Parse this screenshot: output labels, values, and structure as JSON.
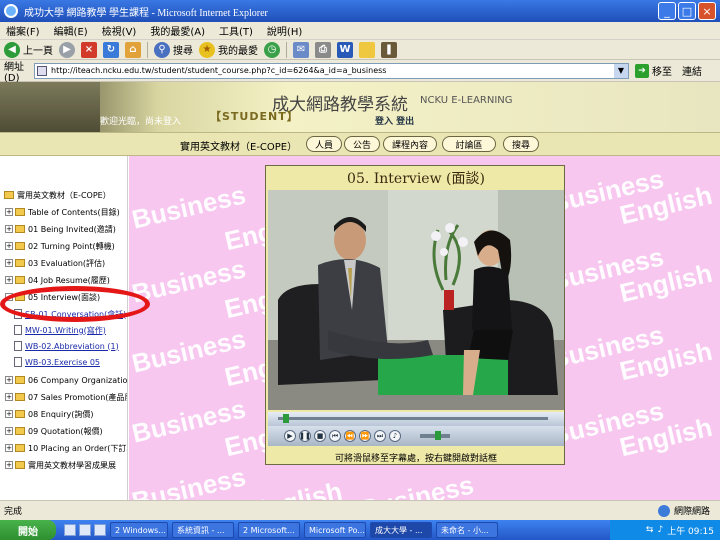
{
  "window": {
    "title": "成功大學 網路教學 學生課程 - Microsoft Internet Explorer",
    "controls": [
      "_",
      "□",
      "×"
    ]
  },
  "menu": [
    "檔案(F)",
    "編輯(E)",
    "檢視(V)",
    "我的最愛(A)",
    "工具(T)",
    "說明(H)"
  ],
  "toolbar": {
    "back": "上一頁",
    "search": "搜尋",
    "favorites": "我的最愛"
  },
  "address": {
    "label": "網址(D)",
    "url": "http://iteach.ncku.edu.tw/student/student_course.php?c_id=6264&a_id=a_business",
    "go": "移至",
    "links": "連結"
  },
  "banner": {
    "student_tag": "【STUDENT】",
    "system_name": "成大網路教學系統",
    "system_en": "NCKU E-LEARNING",
    "welcome": "歡迎光臨，尚未登入",
    "logout": "登入 登出"
  },
  "nav": {
    "course": "實用英文教材（E-COPE）",
    "buttons": [
      "人員",
      "公告",
      "課程內容",
      "討論區",
      "搜尋"
    ]
  },
  "tree": {
    "root": "實用英文教材（E-COPE）",
    "items": [
      "Table of Contents(目錄)",
      "01 Being Invited(邀請)",
      "02 Turning Point(轉機)",
      "03 Evaluation(評估)",
      "04 Job Resume(履歷)",
      "05 Interview(面談)"
    ],
    "sub_items": [
      "SB-01.Conversation(會話)",
      "MW-01.Writing(寫作)",
      "WB-02.Abbreviation (1)",
      "WB-03.Exercise 05"
    ],
    "more_items": [
      "06 Company Organization(公司)",
      "07 Sales Promotion(產品展示)",
      "08 Enquiry(詢價)",
      "09 Quotation(報價)",
      "10 Placing an Order(下訂單)",
      "實用英文教材學習成果展"
    ]
  },
  "watermark": {
    "word1": "Business",
    "word2": "English"
  },
  "player": {
    "title": "05. Interview (面談)",
    "caption": "可將滑鼠移至字幕處，按右鍵開啟對話框",
    "progress": 0.02,
    "volume": 0.6
  },
  "status": {
    "text": "完成",
    "zone": "網際網路"
  },
  "taskbar": {
    "start": "開始",
    "tasks": [
      "2 Windows...",
      "系統資訊 - ...",
      "2 Microsoft...",
      "Microsoft Po...",
      "成大大學 - ...",
      "未命名 - 小..."
    ],
    "clock": "上午 09:15"
  },
  "colors": {
    "content_bg": "#f7c7f0",
    "banner": "#e9e6b3",
    "titlebar": "#2a5fd0",
    "highlight": "#e41616"
  }
}
